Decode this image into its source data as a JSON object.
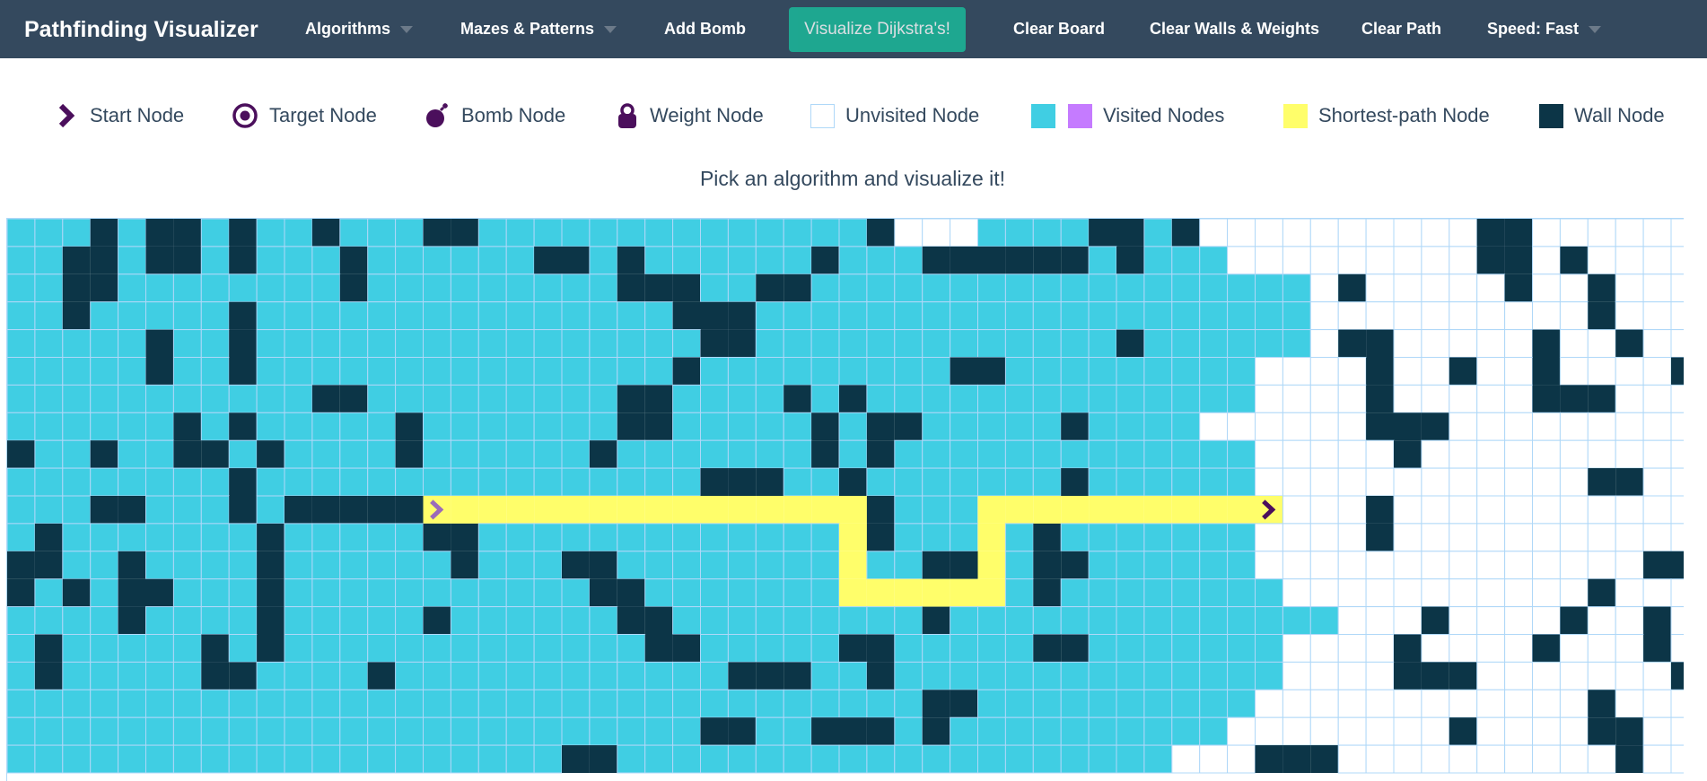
{
  "navbar": {
    "brand": "Pathfinding Visualizer",
    "items": [
      {
        "label": "Algorithms",
        "name": "algorithms-menu",
        "dropdown": true
      },
      {
        "label": "Mazes & Patterns",
        "name": "mazes-patterns-menu",
        "dropdown": true
      },
      {
        "label": "Add Bomb",
        "name": "add-bomb-button",
        "dropdown": false
      },
      {
        "label": "Clear Board",
        "name": "clear-board-button",
        "dropdown": false
      },
      {
        "label": "Clear Walls & Weights",
        "name": "clear-walls-weights-button",
        "dropdown": false
      },
      {
        "label": "Clear Path",
        "name": "clear-path-button",
        "dropdown": false
      },
      {
        "label": "Speed: Fast",
        "name": "speed-menu",
        "dropdown": true
      }
    ],
    "visualize_label": "Visualize Dijkstra's!",
    "colors": {
      "background": "#34495e",
      "accent": "#1abc9c"
    }
  },
  "legend": {
    "start": "Start Node",
    "target": "Target Node",
    "bomb": "Bomb Node",
    "weight": "Weight Node",
    "unvisited": "Unvisited Node",
    "visited": "Visited Nodes",
    "shortest": "Shortest-path Node",
    "wall": "Wall Node"
  },
  "icons": {
    "start": "chevron-right-icon",
    "target": "target-circle-icon",
    "bomb": "bomb-icon",
    "weight": "weight-icon"
  },
  "instruction": "Pick an algorithm and visualize it!",
  "colors": {
    "visited": "#40cee3",
    "visited_alt": "#c57bff",
    "wall": "#0c3547",
    "shortest": "#fffe6a",
    "unvisited_border": "#afd8f8",
    "icon": "#4b0f5c"
  },
  "grid": {
    "rows": 20,
    "cols": 62,
    "start": [
      10,
      15
    ],
    "target": [
      10,
      45
    ],
    "cells": [
      "VVVWVWWVWVVWVVVWWVVVVVVVVVVVVVVWUUUVVVVWWVWUUUUUUUUUUWWUUUUUUU",
      "VVWWVWWVWVVVWVVVVVVWWVWVVVVVVWVVVWWWWWWVWVVVUUUUUUUUUWWUWUUUUU",
      "VVWWVVVVVVVVWVVVVVVVVVWWWVVWWVVVVVVVVVVVVVVVVVVUWUUUUUWUUWUUUUU",
      "VVWVVVVVWVVVVVVVVVVVVVVVWWWVVVVVVVVVVVVVVVVVVVVUUUUUUUUUUWUUUUU",
      "VVVVVWVVWVVVVVVVVVVVVVVVVWWVVVVVVVVVVVVVWVVVVVVUWWUUUUUWUUWUUUUU",
      "VVVVVWVVWVVVVVVVVVVVVVVVWVVVVVVVVVWWVVVVVVVVVUUUUWUUWUUWUUUUWWUU",
      "VVVVVVVVVVVWWVVVVVVVVVWWVVVVWVWVVVVVVVVVVVVVVUUUUWUUUUUWWWUUUUUU",
      "VVVVVVWVWVVVVVWVVVVVVVWWVVVVVWVWWVVVVVWVVVVUUUUUUWWWUUUUUUUUUUW",
      "WVVWVVWWVWVVVVWVVVVVVWVVVVVVVWVWVVVVVVVVVVVVVUUUUUWUUUUUUUUUUUW",
      "VVVVVVVVWVVVVVVVVVVVVVVVVWWWVVWVVVVVVVWVVVVVVUUUUUUUUUUUUWWUUUUW",
      "VVVWWVVVWVWWWWWWVVVVVVVVVVVVVVVWVVVVVVVVVVVVVVUUUWUUUUUUUUUUUWWU",
      "VWVVVVVVVWVVVVVWWVVVVVVVVVVVVVVWVVVVVWVVVVVVVUUUUWUUUUUUUUUUUUUU",
      "WWVVWVVVVWVVVVVVWVVVWWVVVVVVVVVVVWWVVWWVVVVVVUUUUUUUUUUUUUUWWUUU",
      "WVWVWWVVVWVVVVVVVVVVVWWVVVVVVVVVVVVVVWVVVVVVVVUUUUUUUUUUUWUUUUUU",
      "VVVVWVVVVWVVVVVWVVVVVVWWVVVVVVVVVWVVVVVVVVVVVVVVUUUWUUUUWUUWUUUU",
      "VWVVVVVWVWVVVVVVVVVVVVVWWVVVVVWWVVVVVWWVVVVVVVUUUUWUUUUWUUUWUUUU",
      "VWVVVVVWWVVVVWVVVVVVVVVVVVWWWVVWVVVVVVVVVVVVVVUUUUWWWUUUUUUUWUUU",
      "VVVVVVVVVVVVVVVVVVVVVVVVVVVVVVVVVWWVVVVVVVVVVUUUUUUUUUUUUWUUUWUUU",
      "VVVVVVVVVVVVVVVVVVVVVVVVVWWVVWWWVWVVVVVVVVVVUUUUUUUUWUUUUWWUUUUWW",
      "VVVVVVVVVVVVVVVVVVVVWWVVVVVVVVVVVVVVVVVVVVUUUWWWUUUUUUUUUUWUUUUUW"
    ],
    "path": [
      [
        10,
        15
      ],
      [
        10,
        16
      ],
      [
        10,
        17
      ],
      [
        10,
        18
      ],
      [
        10,
        19
      ],
      [
        10,
        20
      ],
      [
        10,
        21
      ],
      [
        10,
        22
      ],
      [
        10,
        23
      ],
      [
        10,
        24
      ],
      [
        10,
        25
      ],
      [
        10,
        26
      ],
      [
        10,
        27
      ],
      [
        10,
        28
      ],
      [
        10,
        29
      ],
      [
        10,
        30
      ],
      [
        11,
        30
      ],
      [
        12,
        30
      ],
      [
        13,
        30
      ],
      [
        13,
        31
      ],
      [
        13,
        32
      ],
      [
        13,
        33
      ],
      [
        13,
        34
      ],
      [
        13,
        35
      ],
      [
        12,
        35
      ],
      [
        11,
        35
      ],
      [
        10,
        35
      ],
      [
        10,
        36
      ],
      [
        10,
        37
      ],
      [
        10,
        38
      ],
      [
        10,
        39
      ],
      [
        10,
        40
      ],
      [
        10,
        41
      ],
      [
        10,
        42
      ],
      [
        10,
        43
      ],
      [
        10,
        44
      ],
      [
        10,
        45
      ]
    ]
  }
}
